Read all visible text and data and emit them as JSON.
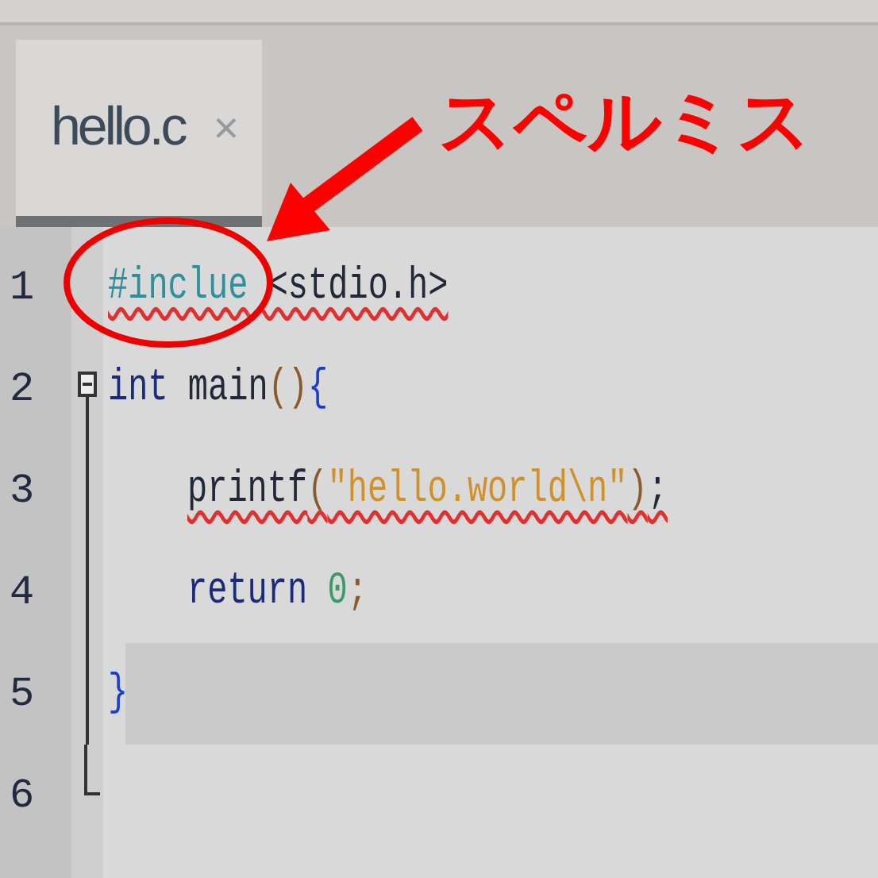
{
  "tabs": [
    {
      "label": "hello.c",
      "close": "×",
      "selected": true
    }
  ],
  "editor": {
    "lines": [
      {
        "number": "1",
        "indent": false,
        "misspelled": true,
        "current": false,
        "folding": false,
        "tokens": [
          {
            "kind": "preprocessor",
            "text": "#inclue"
          },
          {
            "kind": "plain",
            "text": " <stdio.h>"
          }
        ]
      },
      {
        "number": "2",
        "indent": false,
        "misspelled": false,
        "current": false,
        "folding": true,
        "tokens": [
          {
            "kind": "keyword",
            "text": "int"
          },
          {
            "kind": "plain",
            "text": " main"
          },
          {
            "kind": "paren",
            "text": "()"
          },
          {
            "kind": "brace",
            "text": "{"
          }
        ]
      },
      {
        "number": "3",
        "indent": true,
        "misspelled": true,
        "current": false,
        "folding": true,
        "tokens": [
          {
            "kind": "plain",
            "text": "printf"
          },
          {
            "kind": "paren",
            "text": "("
          },
          {
            "kind": "string",
            "text": "\"hello.world\\n\""
          },
          {
            "kind": "paren",
            "text": ")"
          },
          {
            "kind": "plain",
            "text": ";"
          }
        ]
      },
      {
        "number": "4",
        "indent": true,
        "misspelled": false,
        "current": false,
        "folding": true,
        "tokens": [
          {
            "kind": "keyword",
            "text": "return"
          },
          {
            "kind": "number",
            "text": " 0"
          },
          {
            "kind": "paren",
            "text": ";"
          }
        ]
      },
      {
        "number": "5",
        "indent": false,
        "misspelled": false,
        "current": true,
        "folding": true,
        "tokens": [
          {
            "kind": "brace",
            "text": "}"
          }
        ]
      },
      {
        "number": "6",
        "current": false,
        "folding": true
      }
    ]
  },
  "annotation": {
    "label": "スペルミス"
  }
}
